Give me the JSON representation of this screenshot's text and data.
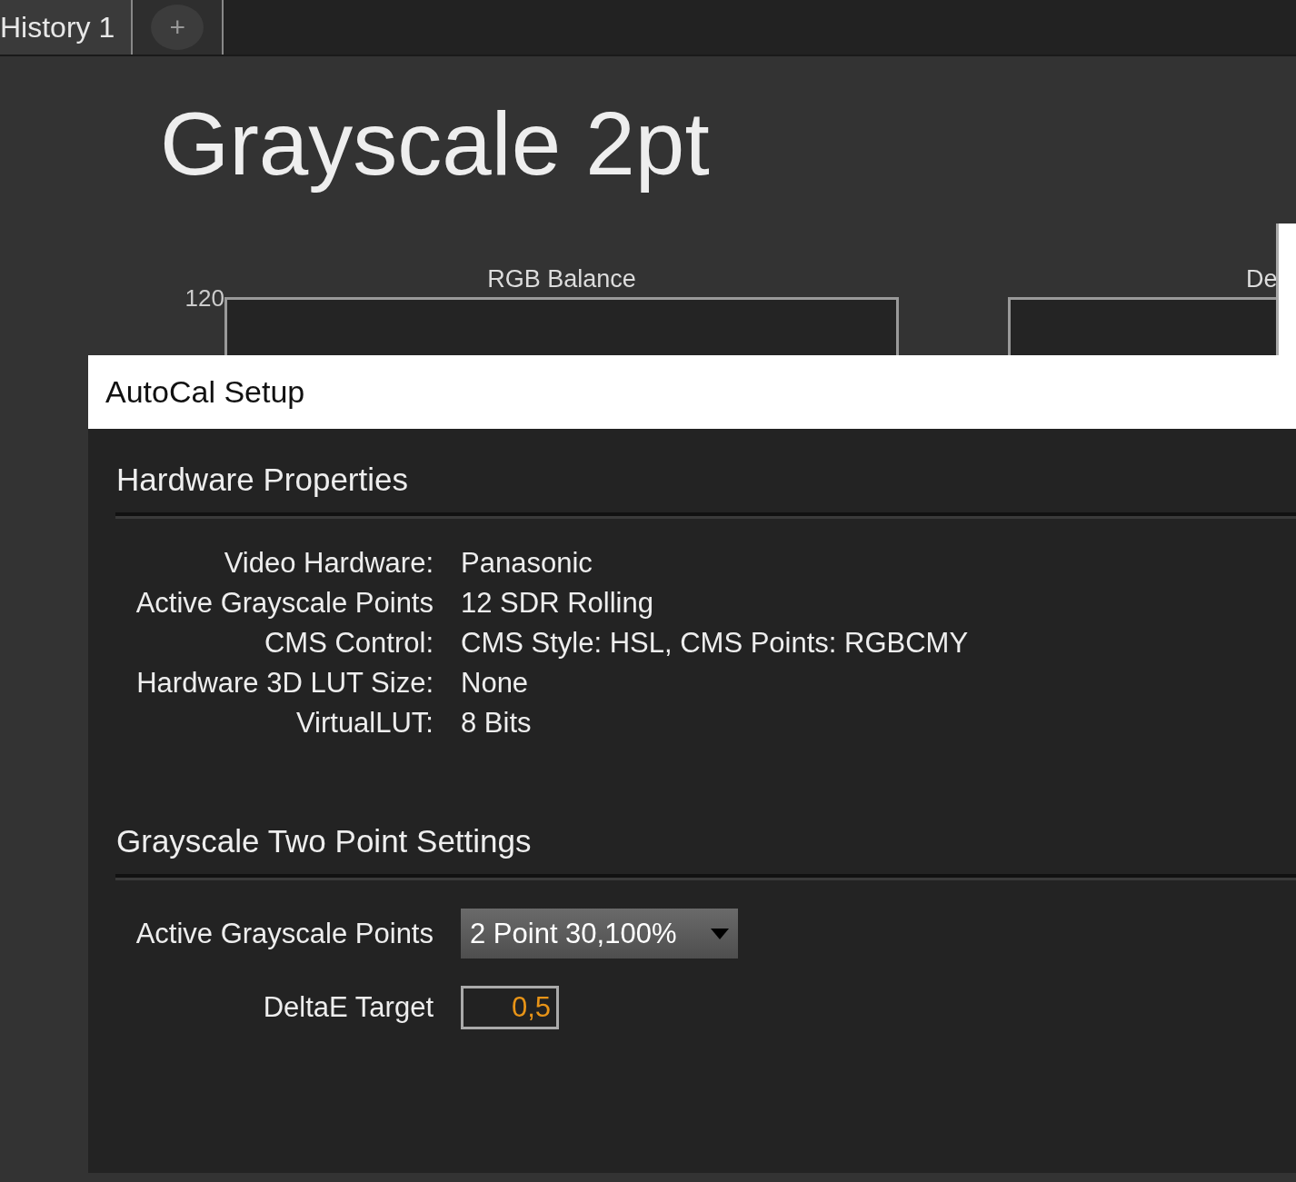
{
  "tabs": [
    {
      "label": "History 1",
      "kind": "tab",
      "selected": true
    },
    {
      "label": "+",
      "kind": "add"
    }
  ],
  "page_title": "Grayscale 2pt",
  "charts": [
    {
      "title": "RGB Balance",
      "y_label": "120"
    },
    {
      "title": "De"
    }
  ],
  "dialog": {
    "title": "AutoCal Setup",
    "sections": [
      {
        "heading": "Hardware Properties",
        "rows": [
          {
            "kind": "info",
            "label": "Video Hardware:",
            "value": "Panasonic"
          },
          {
            "kind": "info",
            "label": "Active Grayscale Points",
            "value": "12 SDR Rolling"
          },
          {
            "kind": "info",
            "label": "CMS Control:",
            "value": "CMS Style: HSL, CMS Points: RGBCMY"
          },
          {
            "kind": "info",
            "label": "Hardware 3D LUT Size:",
            "value": "None"
          },
          {
            "kind": "info",
            "label": "VirtualLUT:",
            "value": "8 Bits"
          }
        ]
      },
      {
        "heading": "Grayscale Two Point Settings",
        "rows": [
          {
            "kind": "dropdown",
            "label": "Active Grayscale Points",
            "value": "2 Point 30,100%"
          },
          {
            "kind": "number",
            "label": "DeltaE Target",
            "value": "0,5"
          }
        ]
      }
    ]
  }
}
